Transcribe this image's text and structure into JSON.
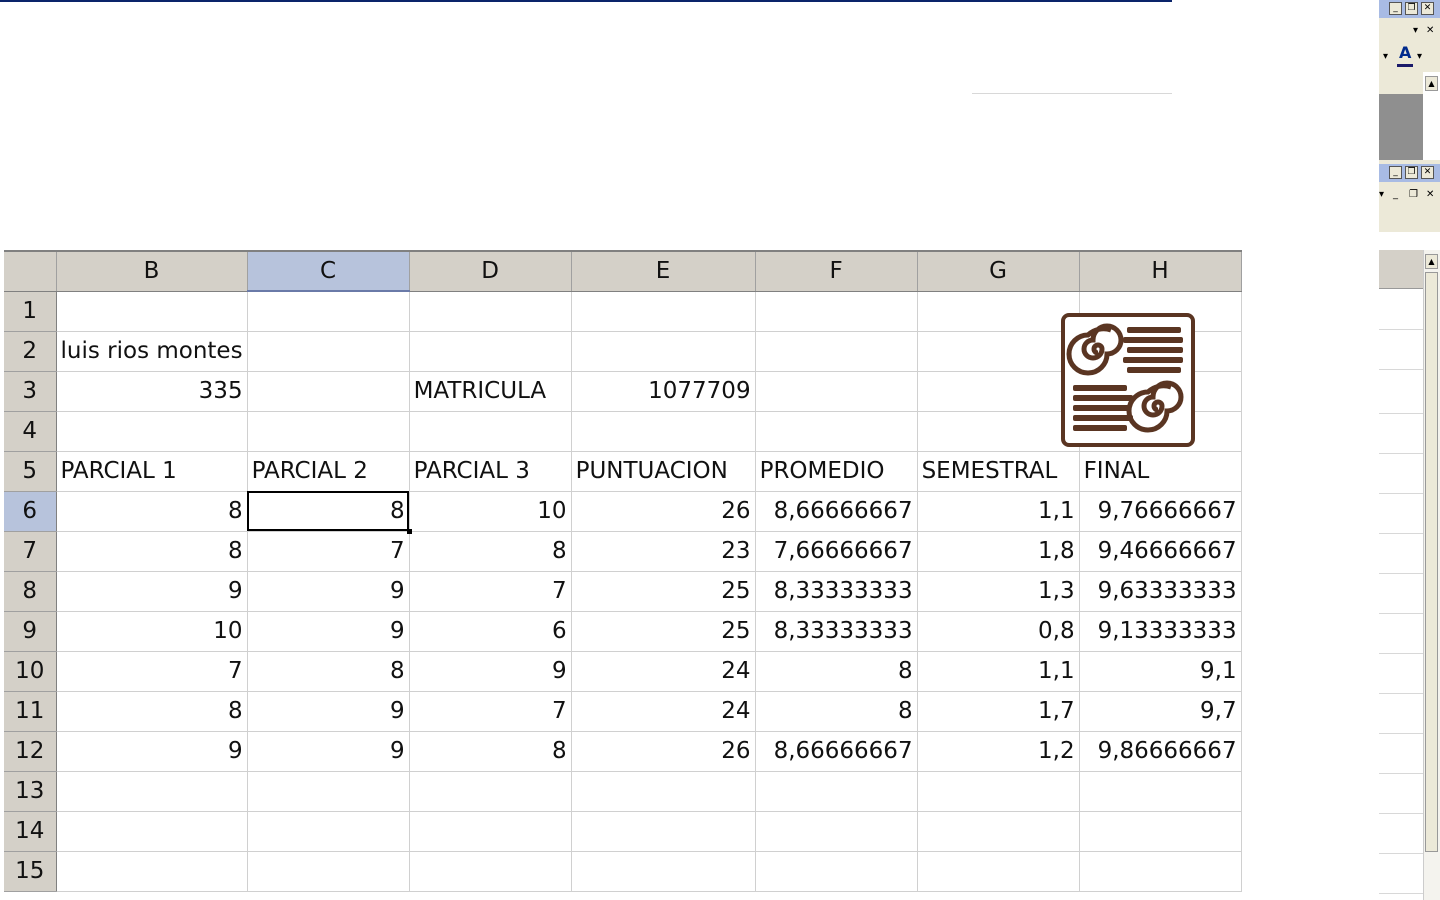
{
  "columns": [
    "B",
    "C",
    "D",
    "E",
    "F",
    "G",
    "H"
  ],
  "selected_column": "C",
  "selected_row": "6",
  "rows": [
    {
      "n": "1",
      "cells": [
        "",
        "",
        "",
        "",
        "",
        "",
        ""
      ]
    },
    {
      "n": "2",
      "cells": [
        "luis rios montes",
        "",
        "",
        "",
        "",
        "",
        ""
      ]
    },
    {
      "n": "3",
      "cells": [
        "335",
        "",
        "MATRICULA",
        "1077709",
        "",
        "",
        ""
      ]
    },
    {
      "n": "4",
      "cells": [
        "",
        "",
        "",
        "",
        "",
        "",
        ""
      ]
    },
    {
      "n": "5",
      "cells": [
        "PARCIAL 1",
        "PARCIAL 2",
        "PARCIAL 3",
        "PUNTUACION",
        "PROMEDIO",
        "SEMESTRAL",
        "FINAL"
      ]
    },
    {
      "n": "6",
      "cells": [
        "8",
        "8",
        "10",
        "26",
        "8,66666667",
        "1,1",
        "9,76666667"
      ]
    },
    {
      "n": "7",
      "cells": [
        "8",
        "7",
        "8",
        "23",
        "7,66666667",
        "1,8",
        "9,46666667"
      ]
    },
    {
      "n": "8",
      "cells": [
        "9",
        "9",
        "7",
        "25",
        "8,33333333",
        "1,3",
        "9,63333333"
      ]
    },
    {
      "n": "9",
      "cells": [
        "10",
        "9",
        "6",
        "25",
        "8,33333333",
        "0,8",
        "9,13333333"
      ]
    },
    {
      "n": "10",
      "cells": [
        "7",
        "8",
        "9",
        "24",
        "8",
        "1,1",
        "9,1"
      ]
    },
    {
      "n": "11",
      "cells": [
        "8",
        "9",
        "7",
        "24",
        "8",
        "1,7",
        "9,7"
      ]
    },
    {
      "n": "12",
      "cells": [
        "9",
        "9",
        "8",
        "26",
        "8,66666667",
        "1,2",
        "9,86666667"
      ]
    },
    {
      "n": "13",
      "cells": [
        "",
        "",
        "",
        "",
        "",
        "",
        ""
      ]
    },
    {
      "n": "14",
      "cells": [
        "",
        "",
        "",
        "",
        "",
        "",
        ""
      ]
    },
    {
      "n": "15",
      "cells": [
        "",
        "",
        "",
        "",
        "",
        "",
        ""
      ]
    }
  ],
  "logo_icon": "books-spiral-logo-icon",
  "colors": {
    "header_bg": "#d4d0c8",
    "selected_header": "#b7c3dc",
    "logo_brown": "#5a3522",
    "title_bar": "#a8bbe4"
  }
}
